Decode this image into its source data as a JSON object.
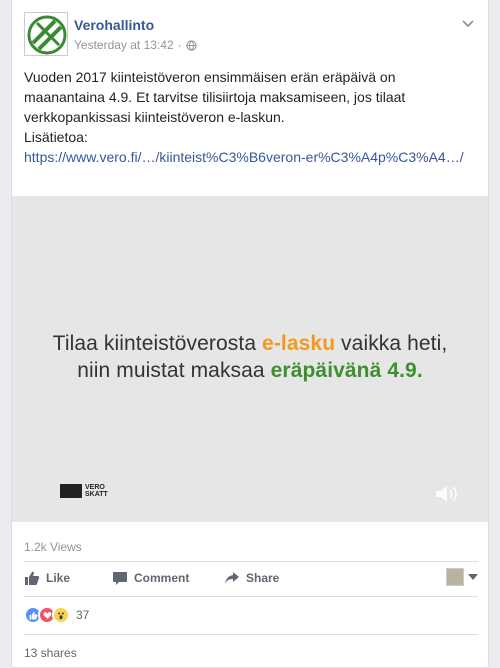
{
  "post": {
    "page_name": "Verohallinto",
    "timestamp": "Yesterday at 13:42",
    "separator": "·",
    "privacy_icon": "globe-icon",
    "text": "Vuoden 2017 kiinteistöveron ensimmäisen erän eräpäivä on maanantaina 4.9. Et tarvitse tilisiirtoja maksamiseen, jos tilaat verkkopankissasi kiinteistöveron e-laskun.",
    "more_info": "Lisätietoa:",
    "link": "https://www.vero.fi/…/kiinteist%C3%B6veron-er%C3%A4p%C3%A4…/"
  },
  "video": {
    "line1_pre": "Tilaa kiinteistöverosta ",
    "line1_hl": "e-lasku",
    "line1_post": " vaikka heti,",
    "line2_pre": "niin muistat maksaa ",
    "line2_hl": "eräpäivänä 4.9.",
    "logo_line1": "VERO",
    "logo_line2": "SKATT",
    "volume_icon": "volume-icon"
  },
  "stats": {
    "views": "1.2k Views",
    "reaction_count": "37",
    "shares": "13 shares"
  },
  "actions": {
    "like": "Like",
    "comment": "Comment",
    "share": "Share"
  },
  "colors": {
    "link": "#365899",
    "orange": "#f39a1e",
    "green": "#3f8f2f"
  }
}
